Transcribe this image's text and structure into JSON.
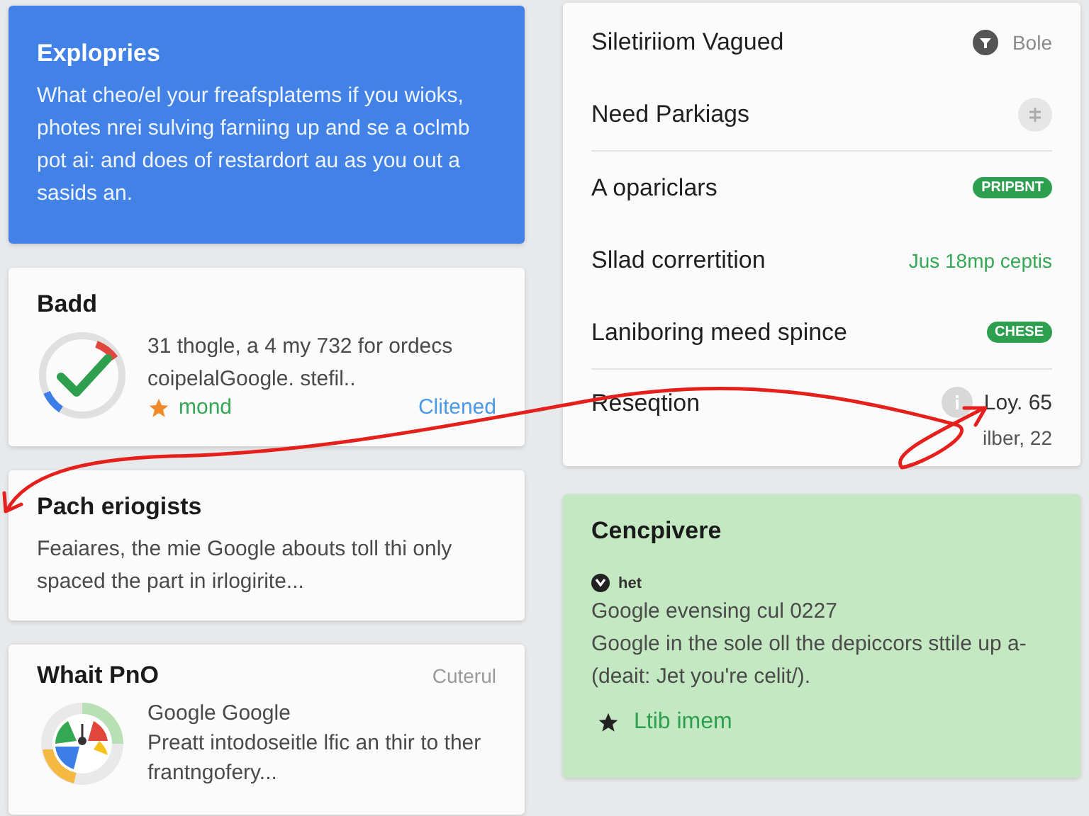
{
  "hero_card": {
    "title": "Explopries",
    "body": "What cheo/el your freafsplatems if you wioks, photes nrei sulving farniing up and se a oclmb pot ai: and does of restardort au as you out a sasids an."
  },
  "status_card": {
    "title": "Badd",
    "body": "31 thogle, a 4 my 732 for ordecs coipelalGoogle. stefil..",
    "tag": "mond",
    "link": "Clitened"
  },
  "article_card": {
    "title": "Pach eriogists",
    "body": "Feaiares, the mie Google abouts toll thi only spaced the part in irlogirite..."
  },
  "summary_card": {
    "title": "Whait PnO",
    "meta": "Cuterul",
    "heading": "Google Google",
    "body": "Preatt intodoseitle lfic an thir to ther frantngofery..."
  },
  "settings_list": [
    {
      "kind": "value",
      "label": "Siletiriiom Vagued",
      "value": "Bole"
    },
    {
      "kind": "add",
      "label": "Need Parkiags"
    },
    {
      "kind": "badge",
      "label": "A opariclars",
      "badge": "PRIPBNT"
    },
    {
      "kind": "note",
      "label": "Sllad corrertition",
      "note": "Jus 18mp ceptis"
    },
    {
      "kind": "badge",
      "label": "Laniboring meed spince",
      "badge": "CHESE"
    },
    {
      "kind": "reading",
      "label": "Reseqtion",
      "value": "Loy. 65",
      "detail": "ilber, 22"
    }
  ],
  "note_card": {
    "title": "Cencpivere",
    "source": "het",
    "heading": "Google evensing cul 0227",
    "body": "Google in the sole oll the depiccors sttile up a-(deait: Jet you're celit/).",
    "action": "Ltib imem"
  }
}
